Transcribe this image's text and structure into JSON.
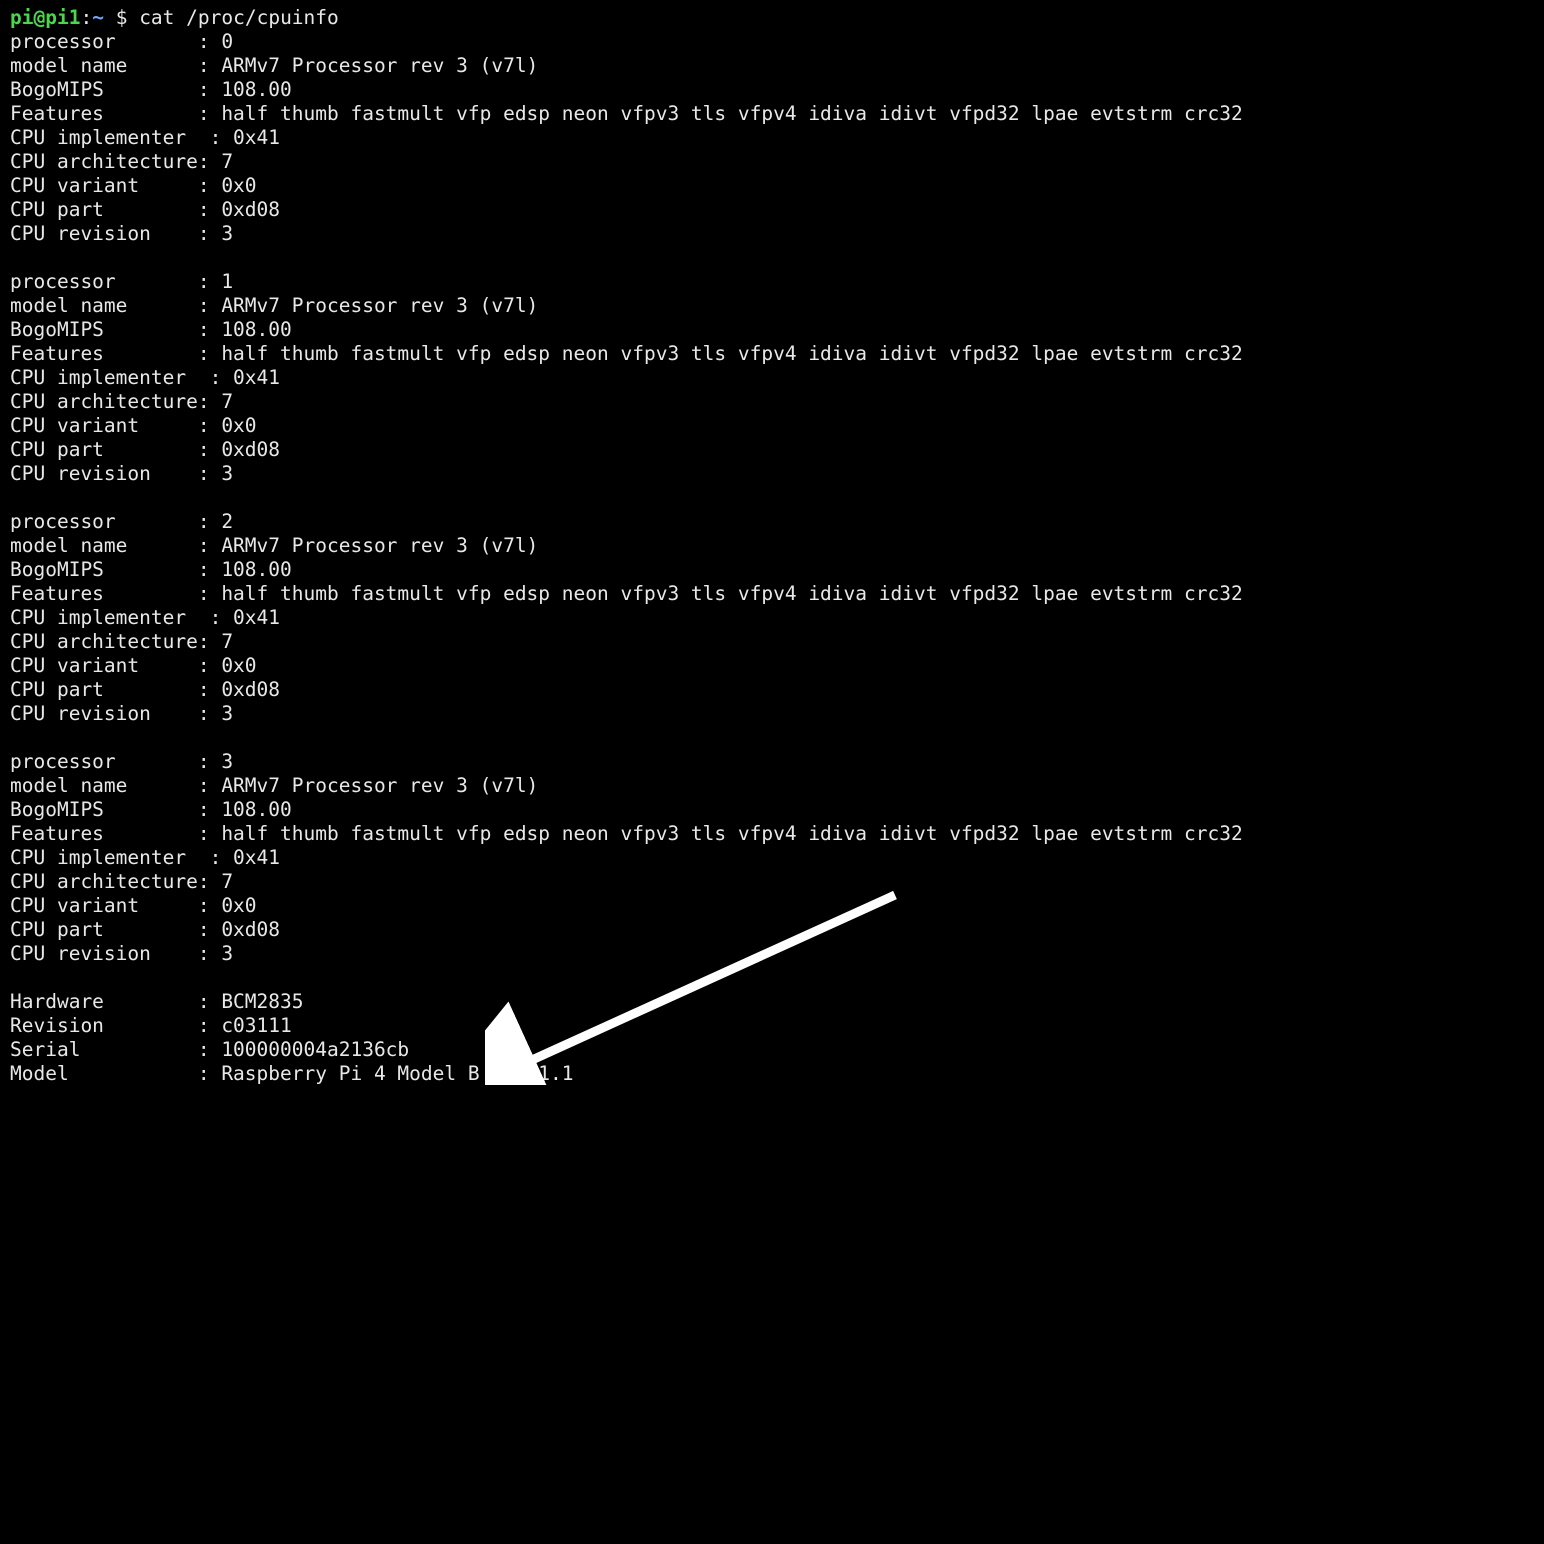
{
  "prompt": {
    "user": "pi",
    "host": "pi1",
    "path": "~",
    "command": "cat /proc/cpuinfo"
  },
  "cpuinfo": {
    "processors": [
      {
        "processor": "0",
        "model_name": "ARMv7 Processor rev 3 (v7l)",
        "BogoMIPS": "108.00",
        "Features": "half thumb fastmult vfp edsp neon vfpv3 tls vfpv4 idiva idivt vfpd32 lpae evtstrm crc32",
        "CPU_implementer": "0x41",
        "CPU_architecture": "7",
        "CPU_variant": "0x0",
        "CPU_part": "0xd08",
        "CPU_revision": "3"
      },
      {
        "processor": "1",
        "model_name": "ARMv7 Processor rev 3 (v7l)",
        "BogoMIPS": "108.00",
        "Features": "half thumb fastmult vfp edsp neon vfpv3 tls vfpv4 idiva idivt vfpd32 lpae evtstrm crc32",
        "CPU_implementer": "0x41",
        "CPU_architecture": "7",
        "CPU_variant": "0x0",
        "CPU_part": "0xd08",
        "CPU_revision": "3"
      },
      {
        "processor": "2",
        "model_name": "ARMv7 Processor rev 3 (v7l)",
        "BogoMIPS": "108.00",
        "Features": "half thumb fastmult vfp edsp neon vfpv3 tls vfpv4 idiva idivt vfpd32 lpae evtstrm crc32",
        "CPU_implementer": "0x41",
        "CPU_architecture": "7",
        "CPU_variant": "0x0",
        "CPU_part": "0xd08",
        "CPU_revision": "3"
      },
      {
        "processor": "3",
        "model_name": "ARMv7 Processor rev 3 (v7l)",
        "BogoMIPS": "108.00",
        "Features": "half thumb fastmult vfp edsp neon vfpv3 tls vfpv4 idiva idivt vfpd32 lpae evtstrm crc32",
        "CPU_implementer": "0x41",
        "CPU_architecture": "7",
        "CPU_variant": "0x0",
        "CPU_part": "0xd08",
        "CPU_revision": "3"
      }
    ],
    "footer": {
      "Hardware": "BCM2835",
      "Revision": "c03111",
      "Serial": "100000004a2136cb",
      "Model": "Raspberry Pi 4 Model B Rev 1.1"
    }
  },
  "labels": {
    "processor": "processor",
    "model_name": "model name",
    "BogoMIPS": "BogoMIPS",
    "Features": "Features",
    "CPU_implementer": "CPU implementer",
    "CPU_architecture": "CPU architecture",
    "CPU_variant": "CPU variant",
    "CPU_part": "CPU part",
    "CPU_revision": "CPU revision",
    "Hardware": "Hardware",
    "Revision": "Revision",
    "Serial": "Serial",
    "Model": "Model"
  }
}
